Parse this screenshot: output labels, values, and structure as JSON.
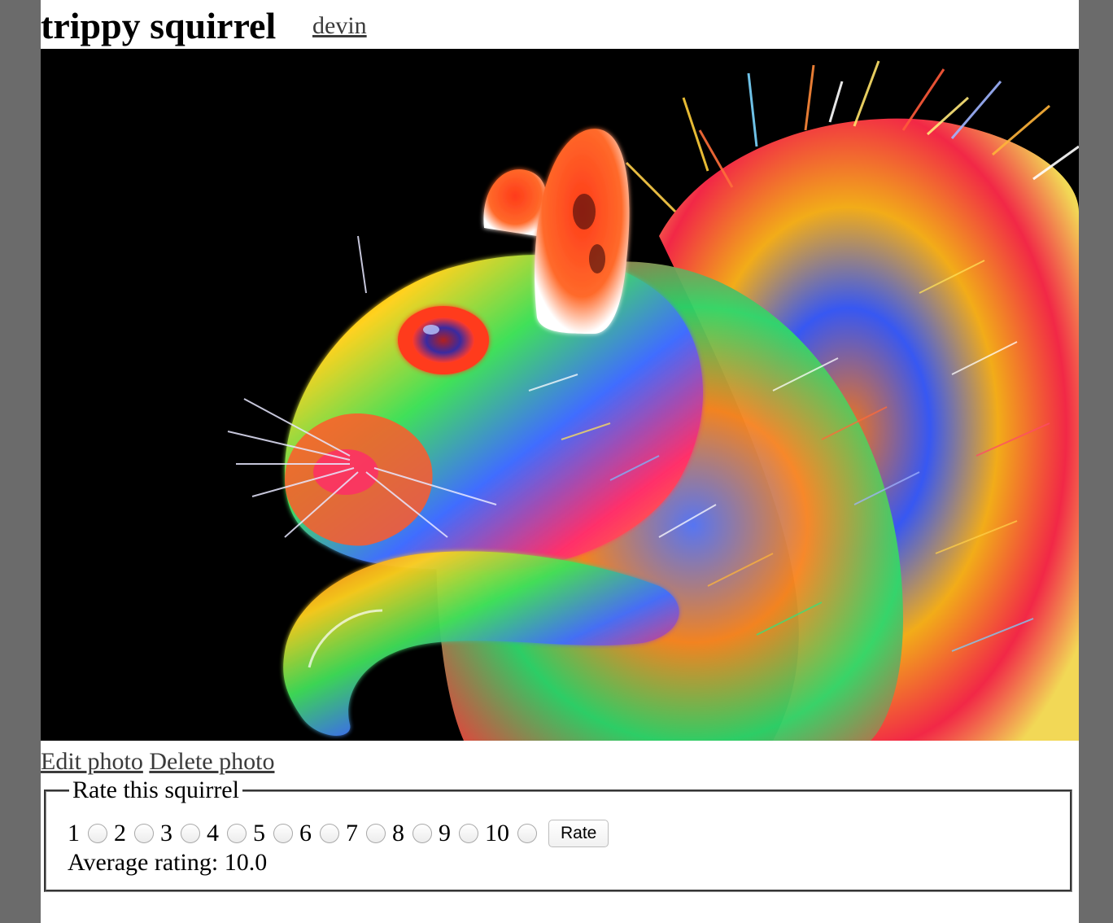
{
  "page": {
    "title": "trippy squirrel",
    "author": "devin"
  },
  "photo": {
    "subject": "squirrel"
  },
  "actions": {
    "edit": "Edit photo",
    "delete": "Delete photo"
  },
  "rating": {
    "legend": "Rate this squirrel",
    "options": [
      "1",
      "2",
      "3",
      "4",
      "5",
      "6",
      "7",
      "8",
      "9",
      "10"
    ],
    "button": "Rate",
    "average_label": "Average rating:",
    "average_value": "10.0"
  },
  "colors": {
    "window_background": "#6b6b6b",
    "page_background": "#ffffff",
    "link": "#3b3b3b"
  }
}
